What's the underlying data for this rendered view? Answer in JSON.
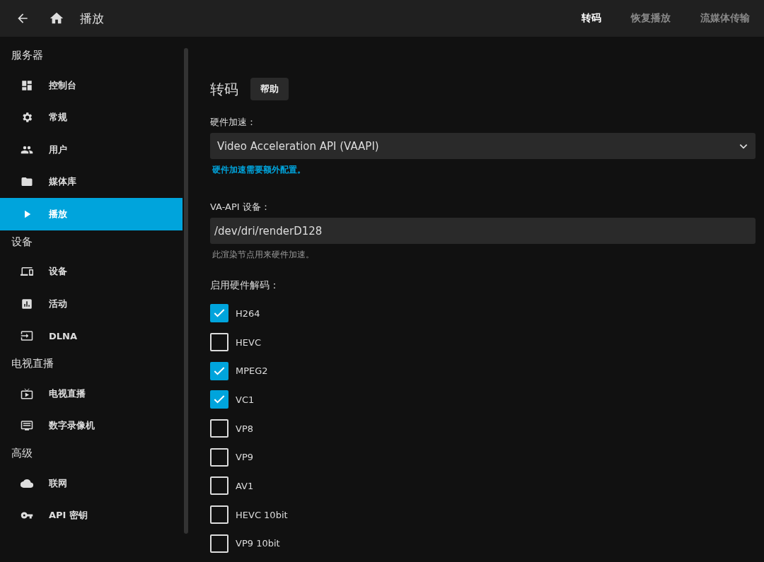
{
  "header": {
    "title": "播放",
    "tabs": [
      {
        "label": "转码",
        "selected": true
      },
      {
        "label": "恢复播放",
        "selected": false
      },
      {
        "label": "流媒体传输",
        "selected": false
      }
    ]
  },
  "sidebar": {
    "sections": [
      {
        "heading": "服务器",
        "items": [
          {
            "label": "控制台",
            "selected": false
          },
          {
            "label": "常规",
            "selected": false
          },
          {
            "label": "用户",
            "selected": false
          },
          {
            "label": "媒体库",
            "selected": false
          },
          {
            "label": "播放",
            "selected": true
          }
        ]
      },
      {
        "heading": "设备",
        "items": [
          {
            "label": "设备",
            "selected": false
          },
          {
            "label": "活动",
            "selected": false
          },
          {
            "label": "DLNA",
            "selected": false
          }
        ]
      },
      {
        "heading": "电视直播",
        "items": [
          {
            "label": "电视直播",
            "selected": false
          },
          {
            "label": "数字录像机",
            "selected": false
          }
        ]
      },
      {
        "heading": "高级",
        "items": [
          {
            "label": "联网",
            "selected": false
          },
          {
            "label": "API 密钥",
            "selected": false
          }
        ]
      }
    ]
  },
  "content": {
    "title": "转码",
    "help_button": "帮助",
    "hw_accel": {
      "label": "硬件加速：",
      "value": "Video Acceleration API (VAAPI)",
      "note": "硬件加速需要额外配置。"
    },
    "vaapi_device": {
      "label": "VA-API 设备：",
      "value": "/dev/dri/renderD128",
      "hint": "此渲染节点用来硬件加速。"
    },
    "decoding": {
      "label": "启用硬件解码：",
      "codecs": [
        {
          "label": "H264",
          "checked": true
        },
        {
          "label": "HEVC",
          "checked": false
        },
        {
          "label": "MPEG2",
          "checked": true
        },
        {
          "label": "VC1",
          "checked": true
        },
        {
          "label": "VP8",
          "checked": false
        },
        {
          "label": "VP9",
          "checked": false
        },
        {
          "label": "AV1",
          "checked": false
        },
        {
          "label": "HEVC 10bit",
          "checked": false
        },
        {
          "label": "VP9 10bit",
          "checked": false
        }
      ]
    }
  }
}
